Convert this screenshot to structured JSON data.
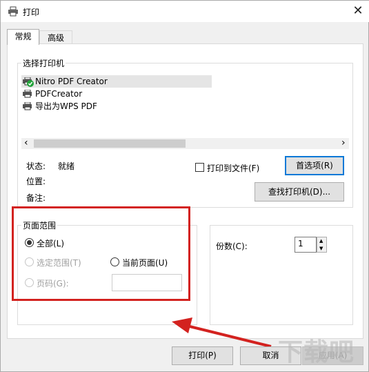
{
  "window": {
    "title": "打印",
    "close_glyph": "✕"
  },
  "tabs": [
    {
      "label": "常规",
      "active": true
    },
    {
      "label": "高级",
      "active": false
    }
  ],
  "printer_group": {
    "legend": "选择打印机",
    "printers": [
      {
        "name": "Nitro PDF Creator",
        "selected": true,
        "default": true
      },
      {
        "name": "PDFCreator",
        "selected": false,
        "default": false
      },
      {
        "name": "导出为WPS PDF",
        "selected": false,
        "default": false
      }
    ],
    "scroll_left": "‹",
    "scroll_right": "›",
    "status_label": "状态:",
    "status_value": "就绪",
    "location_label": "位置:",
    "comment_label": "备注:",
    "print_to_file_label": "打印到文件(F)",
    "print_to_file_checked": false,
    "preferences_button": "首选项(R)",
    "find_printer_button": "查找打印机(D)..."
  },
  "page_range": {
    "legend": "页面范围",
    "all_label": "全部(L)",
    "selection_label": "选定范围(T)",
    "current_page_label": "当前页面(U)",
    "pages_label": "页码(G):",
    "pages_value": "",
    "selected_option": "all"
  },
  "copies": {
    "label": "份数(C):",
    "value": "1",
    "up_glyph": "▲",
    "down_glyph": "▼"
  },
  "buttons": {
    "print": "打印(P)",
    "cancel": "取消",
    "apply": "应用(A)"
  },
  "watermark": {
    "text": "下载吧"
  },
  "colors": {
    "annotation_red": "#d3221f",
    "focus_blue": "#0078d7",
    "default_check_green": "#22a33a"
  }
}
